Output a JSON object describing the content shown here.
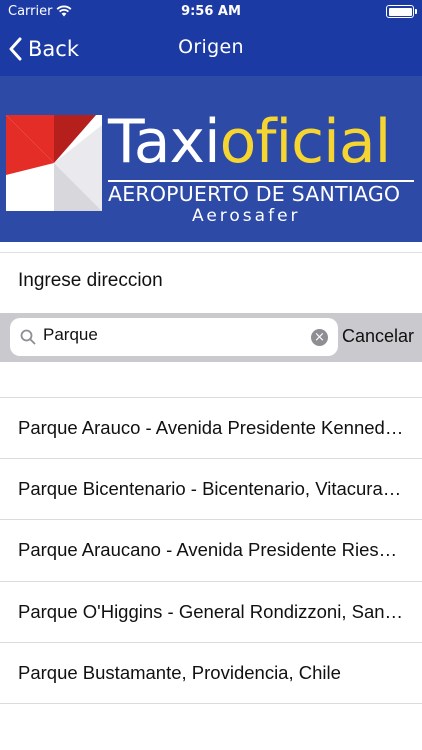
{
  "status": {
    "carrier": "Carrier",
    "time": "9:56 AM"
  },
  "nav": {
    "back_label": "Back",
    "title": "Origen"
  },
  "banner": {
    "brand_part1": "Taxi",
    "brand_part2": "oficial",
    "subtitle": "AEROPUERTO DE SANTIAGO",
    "tagline": "Aerosafer"
  },
  "form": {
    "label": "Ingrese direccion"
  },
  "search": {
    "value": "Parque",
    "cancel_label": "Cancelar"
  },
  "results": [
    {
      "label": "Parque Arauco - Avenida Presidente Kennedy L..."
    },
    {
      "label": "Parque Bicentenario - Bicentenario, Vitacura, C..."
    },
    {
      "label": "Parque Araucano - Avenida Presidente Riesco, ..."
    },
    {
      "label": "Parque O'Higgins - General Rondizzoni, Santiag..."
    },
    {
      "label": "Parque Bustamante, Providencia, Chile"
    }
  ],
  "colors": {
    "nav_bg": "#1c3aa3",
    "banner_bg": "#2c4aa6",
    "brand_yellow": "#f7d531",
    "searchbar_bg": "#c9c9ce"
  }
}
